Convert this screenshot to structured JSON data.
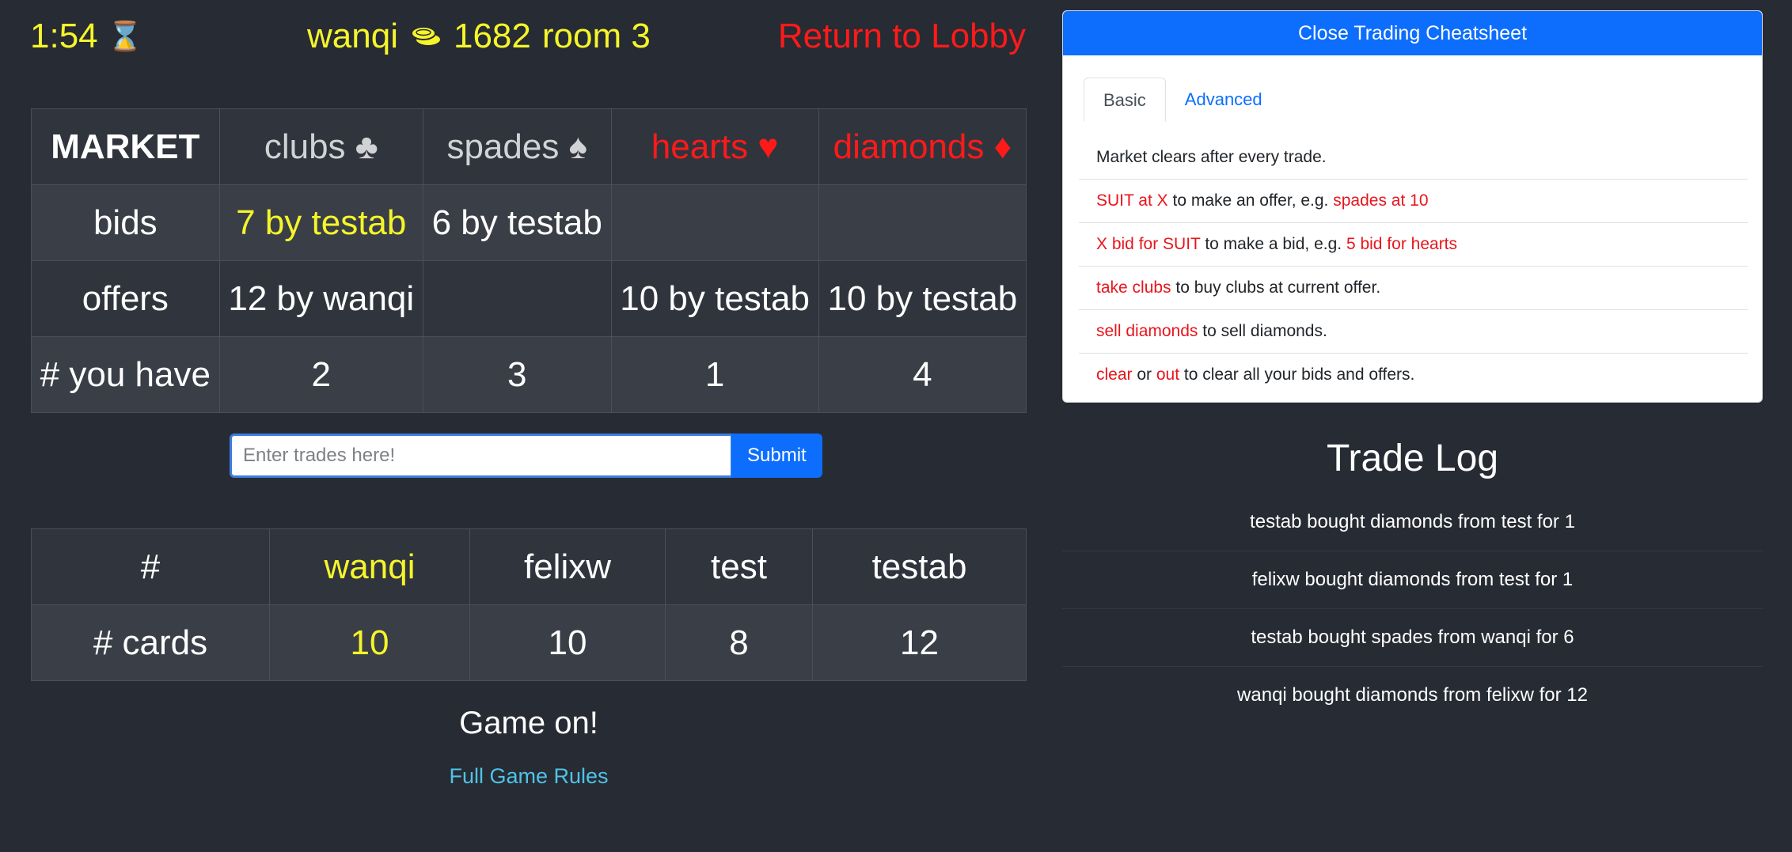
{
  "header": {
    "timer": "1:54",
    "timer_icon": "hourglass-icon",
    "timer_glyph": "⌛",
    "username": "wanqi",
    "coins_icon": "coins-icon",
    "coins": "1682",
    "room": "room 3",
    "return_link": "Return to Lobby"
  },
  "colors": {
    "background": "#272b33",
    "highlight_yellow": "#f5f52a",
    "alert_red": "#ff1a1a",
    "primary_blue": "#0d6efd",
    "link_cyan": "#4fc3e8"
  },
  "market": {
    "corner": "MARKET",
    "suits": [
      {
        "name": "clubs",
        "glyph": "♣",
        "color": "gray"
      },
      {
        "name": "spades",
        "glyph": "♠",
        "color": "gray"
      },
      {
        "name": "hearts",
        "glyph": "♥",
        "color": "red"
      },
      {
        "name": "diamonds",
        "glyph": "♦",
        "color": "red"
      }
    ],
    "rows": [
      {
        "label": "bids",
        "cells": [
          "7 by testab",
          "6 by testab",
          "",
          ""
        ]
      },
      {
        "label": "offers",
        "cells": [
          "12 by wanqi",
          "",
          "10 by testab",
          "10 by testab"
        ]
      },
      {
        "label": "# you have",
        "cells": [
          "2",
          "3",
          "1",
          "4"
        ]
      }
    ]
  },
  "trade_input": {
    "placeholder": "Enter trades here!",
    "value": "",
    "submit_label": "Submit"
  },
  "players": {
    "header_label": "#",
    "names": [
      "wanqi",
      "felixw",
      "test",
      "testab"
    ],
    "cards_label": "# cards",
    "cards": [
      "10",
      "10",
      "8",
      "12"
    ]
  },
  "status": {
    "message": "Game on!",
    "rules_link": "Full Game Rules"
  },
  "cheatsheet": {
    "close_label": "Close Trading Cheatsheet",
    "tabs": [
      {
        "label": "Basic",
        "active": true
      },
      {
        "label": "Advanced",
        "active": false
      }
    ],
    "rules": [
      {
        "kw1": "",
        "t1": "Market clears after every trade.",
        "kw2": "",
        "t2": "",
        "kw3": "",
        "t3": ""
      },
      {
        "kw1": "SUIT at X",
        "t1": " to make an offer, e.g. ",
        "kw2": "spades at 10",
        "t2": "",
        "kw3": "",
        "t3": ""
      },
      {
        "kw1": "X bid for SUIT",
        "t1": " to make a bid, e.g. ",
        "kw2": "5 bid for hearts",
        "t2": "",
        "kw3": "",
        "t3": ""
      },
      {
        "kw1": "take clubs",
        "t1": " to buy clubs at current offer.",
        "kw2": "",
        "t2": "",
        "kw3": "",
        "t3": ""
      },
      {
        "kw1": "sell diamonds",
        "t1": " to sell diamonds.",
        "kw2": "",
        "t2": "",
        "kw3": "",
        "t3": ""
      },
      {
        "kw1": "clear",
        "t1": " or ",
        "kw2": "out",
        "t2": " to clear all your bids and offers.",
        "kw3": "",
        "t3": ""
      }
    ]
  },
  "trade_log": {
    "title": "Trade Log",
    "entries": [
      "testab bought diamonds from test for 1",
      "felixw bought diamonds from test for 1",
      "testab bought spades from wanqi for 6",
      "wanqi bought diamonds from felixw for 12"
    ]
  }
}
